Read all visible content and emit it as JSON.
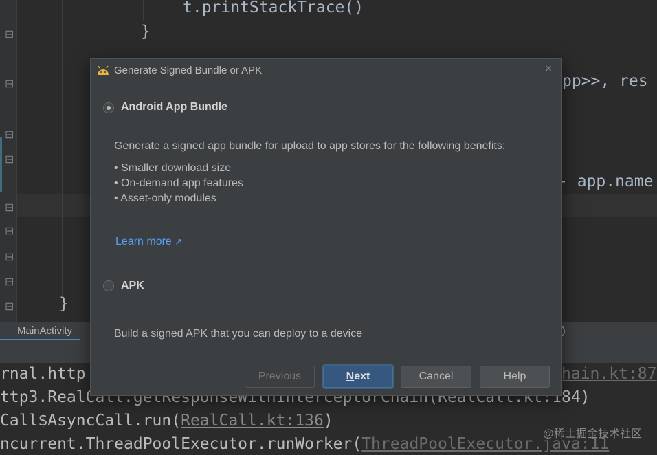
{
  "editor": {
    "lines": [
      "t.printStackTrace()",
      "}",
      "pp>>, res",
      "- app.name",
      "}"
    ]
  },
  "tabs": {
    "main_tab": "MainActivity",
    "right_fragment": "st)"
  },
  "console": {
    "line1_pre": "rnal.http",
    "line1_link": "hain.kt:87",
    "line2": "ttp3.RealCall.getResponseWithInterceptorChain(RealCall.kt:184)",
    "line3_pre": "Call$AsyncCall.run(",
    "line3_link": "RealCall.kt:136",
    "line3_post": ")",
    "line4_pre": "ncurrent.ThreadPoolExecutor.runWorker(",
    "line4_link": "ThreadPoolExecutor.java:11"
  },
  "watermark": "@稀土掘金技术社区",
  "dialog": {
    "title": "Generate Signed Bundle or APK",
    "close_glyph": "×",
    "options": [
      {
        "label": "Android App Bundle",
        "selected": true,
        "description": "Generate a signed app bundle for upload to app stores for the following benefits:",
        "bullets": [
          "• Smaller download size",
          "• On-demand app features",
          "• Asset-only modules"
        ],
        "link": "Learn more",
        "link_arrow": "↗"
      },
      {
        "label": "APK",
        "selected": false,
        "description": "Build a signed APK that you can deploy to a device"
      }
    ],
    "buttons": {
      "previous": "Previous",
      "next_first": "N",
      "next_rest": "ext",
      "cancel": "Cancel",
      "help": "Help"
    }
  },
  "colors": {
    "accent": "#589df6",
    "default_button": "#365880",
    "android_icon": "#e5b441"
  }
}
